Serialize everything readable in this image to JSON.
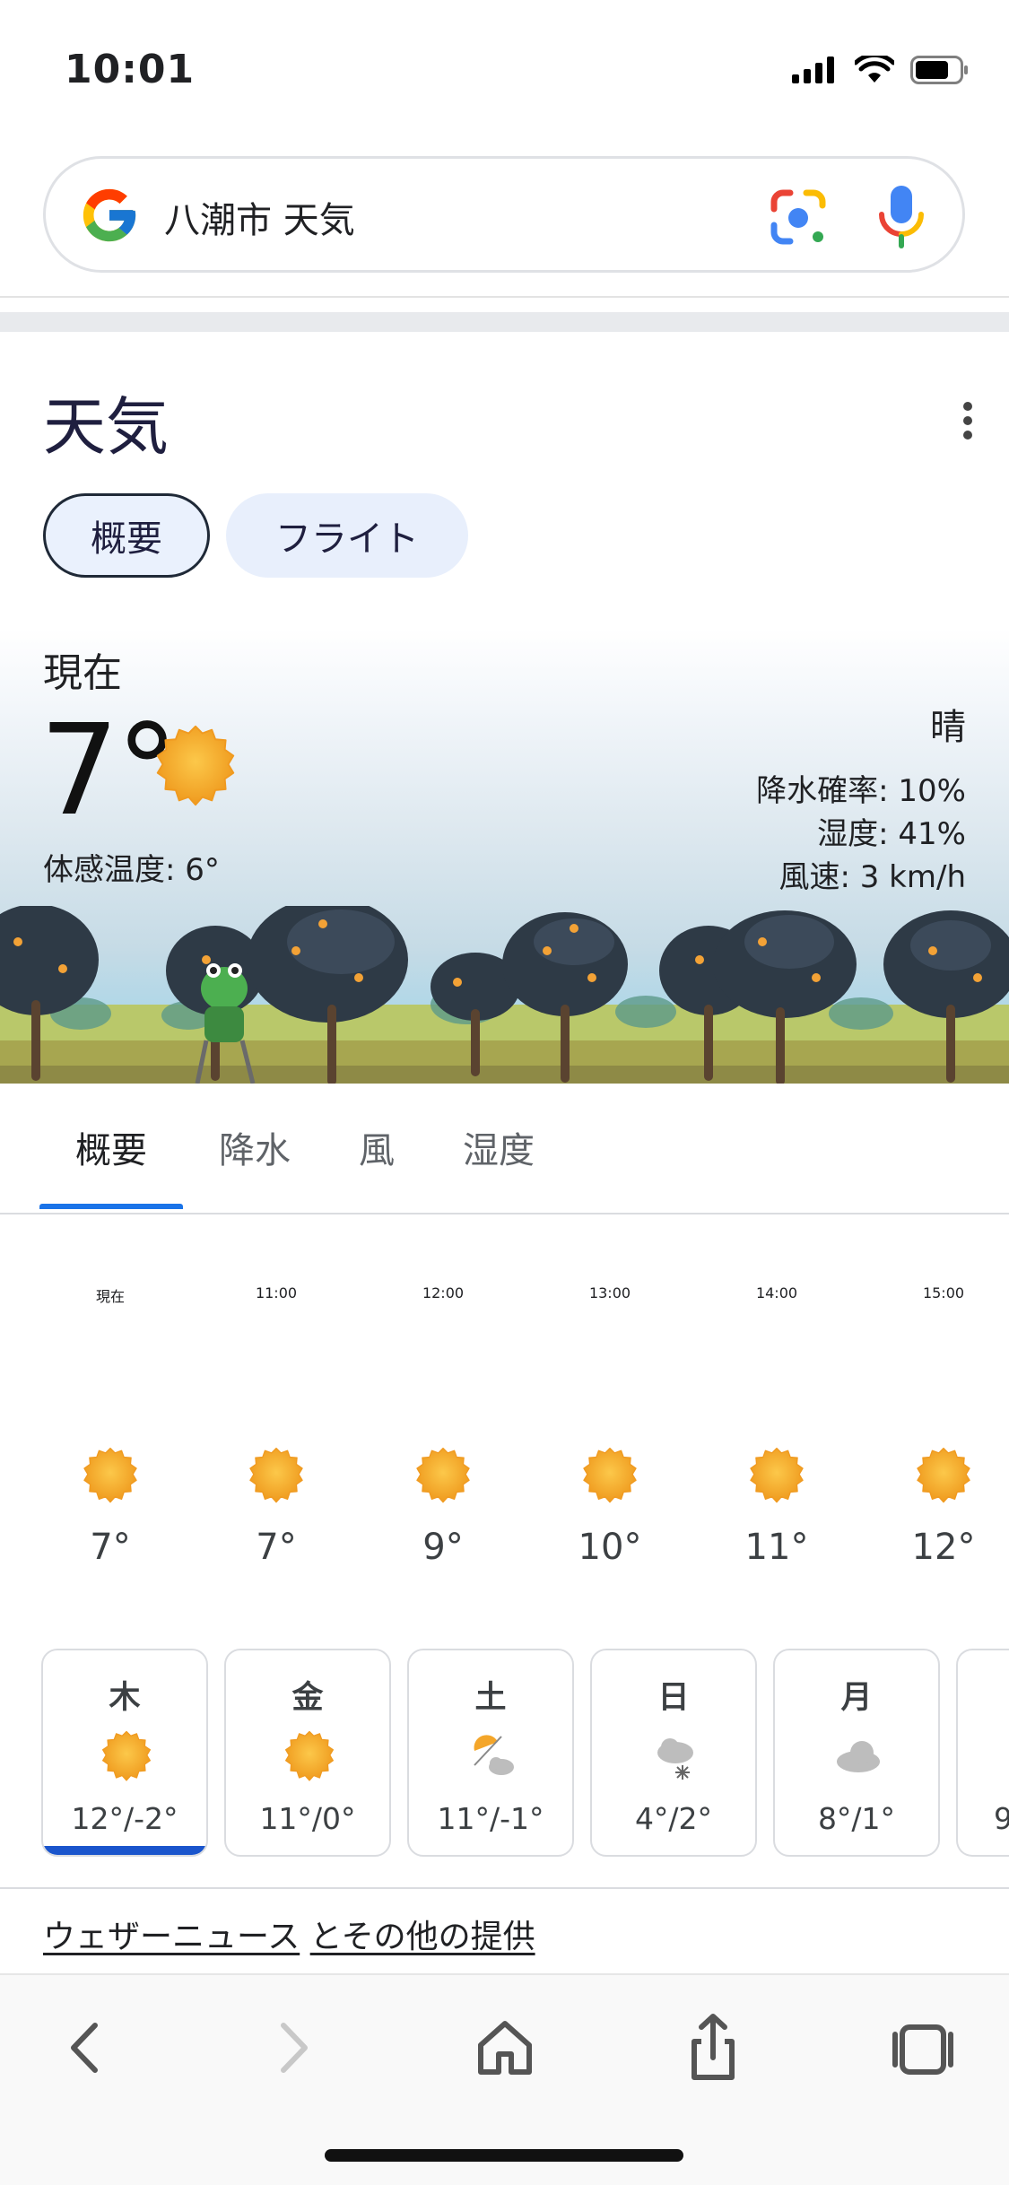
{
  "status_bar": {
    "time": "10:01"
  },
  "search": {
    "query": "八潮市 天気"
  },
  "weather": {
    "title": "天気",
    "chips": [
      "概要",
      "フライト"
    ],
    "current": {
      "label": "現在",
      "temp": "7°",
      "feels_like": "体感温度: 6°",
      "condition": "晴",
      "precip": "降水確率: 10%",
      "humidity": "湿度: 41%",
      "wind": "風速: 3 km/h"
    },
    "tabs": [
      "概要",
      "降水",
      "風",
      "湿度"
    ],
    "hourly": [
      {
        "time": "現在",
        "temp": "7°",
        "icon": "sunny-icon"
      },
      {
        "time": "11:00",
        "temp": "7°",
        "icon": "sunny-icon"
      },
      {
        "time": "12:00",
        "temp": "9°",
        "icon": "sunny-icon"
      },
      {
        "time": "13:00",
        "temp": "10°",
        "icon": "sunny-icon"
      },
      {
        "time": "14:00",
        "temp": "11°",
        "icon": "sunny-icon"
      },
      {
        "time": "15:00",
        "temp": "12°",
        "icon": "sunny-icon"
      }
    ],
    "daily": [
      {
        "day": "木",
        "temp": "12°/-2°",
        "icon": "sunny-icon"
      },
      {
        "day": "金",
        "temp": "11°/0°",
        "icon": "sunny-icon"
      },
      {
        "day": "土",
        "temp": "11°/-1°",
        "icon": "partly-cloudy-icon"
      },
      {
        "day": "日",
        "temp": "4°/2°",
        "icon": "snow-cloud-icon"
      },
      {
        "day": "月",
        "temp": "8°/1°",
        "icon": "cloudy-icon"
      },
      {
        "day": "",
        "temp": "9",
        "icon": ""
      }
    ],
    "source": {
      "provider": "ウェザーニュース",
      "others": "とその他の提供"
    }
  },
  "colors": {
    "accent_blue": "#1a73e8",
    "sun_orange": "#f4a62a",
    "chip_bg": "#e8effc"
  }
}
